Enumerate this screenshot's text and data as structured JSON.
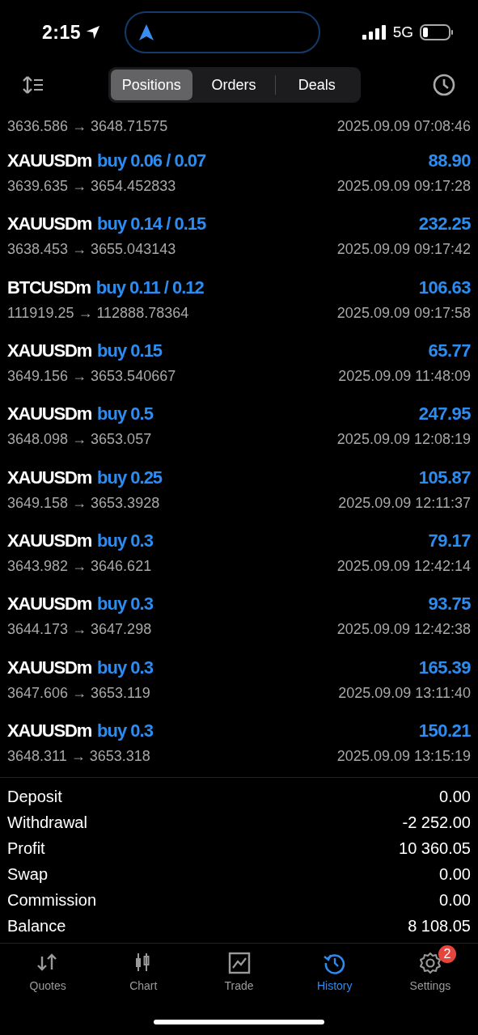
{
  "status_bar": {
    "time": "2:15",
    "network": "5G"
  },
  "segments": [
    {
      "label": "Positions",
      "selected": true
    },
    {
      "label": "Orders",
      "selected": false
    },
    {
      "label": "Deals",
      "selected": false
    }
  ],
  "partial_trade": {
    "prices": "3636.586 → 3648.71575",
    "time": "2025.09.09 07:08:46"
  },
  "trades": [
    {
      "symbol": "XAUUSDm",
      "order": "buy 0.06 / 0.07",
      "profit": "88.90",
      "prices": "3639.635 → 3654.452833",
      "time": "2025.09.09 09:17:28"
    },
    {
      "symbol": "XAUUSDm",
      "order": "buy 0.14 / 0.15",
      "profit": "232.25",
      "prices": "3638.453 → 3655.043143",
      "time": "2025.09.09 09:17:42"
    },
    {
      "symbol": "BTCUSDm",
      "order": "buy 0.11 / 0.12",
      "profit": "106.63",
      "prices": "111919.25 → 112888.78364",
      "time": "2025.09.09 09:17:58"
    },
    {
      "symbol": "XAUUSDm",
      "order": "buy 0.15",
      "profit": "65.77",
      "prices": "3649.156 → 3653.540667",
      "time": "2025.09.09 11:48:09"
    },
    {
      "symbol": "XAUUSDm",
      "order": "buy 0.5",
      "profit": "247.95",
      "prices": "3648.098 → 3653.057",
      "time": "2025.09.09 12:08:19"
    },
    {
      "symbol": "XAUUSDm",
      "order": "buy 0.25",
      "profit": "105.87",
      "prices": "3649.158 → 3653.3928",
      "time": "2025.09.09 12:11:37"
    },
    {
      "symbol": "XAUUSDm",
      "order": "buy 0.3",
      "profit": "79.17",
      "prices": "3643.982 → 3646.621",
      "time": "2025.09.09 12:42:14"
    },
    {
      "symbol": "XAUUSDm",
      "order": "buy 0.3",
      "profit": "93.75",
      "prices": "3644.173 → 3647.298",
      "time": "2025.09.09 12:42:38"
    },
    {
      "symbol": "XAUUSDm",
      "order": "buy 0.3",
      "profit": "165.39",
      "prices": "3647.606 → 3653.119",
      "time": "2025.09.09 13:11:40"
    },
    {
      "symbol": "XAUUSDm",
      "order": "buy 0.3",
      "profit": "150.21",
      "prices": "3648.311 → 3653.318",
      "time": "2025.09.09 13:15:19"
    }
  ],
  "summary": [
    {
      "label": "Deposit",
      "value": "0.00"
    },
    {
      "label": "Withdrawal",
      "value": "-2 252.00"
    },
    {
      "label": "Profit",
      "value": "10 360.05"
    },
    {
      "label": "Swap",
      "value": "0.00"
    },
    {
      "label": "Commission",
      "value": "0.00"
    },
    {
      "label": "Balance",
      "value": "8 108.05"
    }
  ],
  "tab_bar": [
    {
      "label": "Quotes",
      "kind": "quotes",
      "selected": false
    },
    {
      "label": "Chart",
      "kind": "chart",
      "selected": false
    },
    {
      "label": "Trade",
      "kind": "trade",
      "selected": false
    },
    {
      "label": "History",
      "kind": "history",
      "selected": true
    },
    {
      "label": "Settings",
      "kind": "settings",
      "selected": false,
      "badge": "2"
    }
  ]
}
